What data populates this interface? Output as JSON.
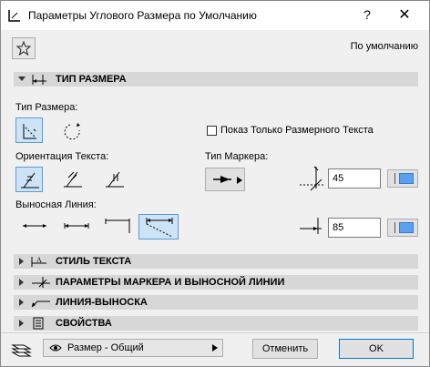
{
  "window": {
    "title": "Параметры Углового Размера по Умолчанию",
    "help": "?",
    "close": "✕"
  },
  "toolbar": {
    "default_label": "По умолчанию"
  },
  "sections": {
    "dim_type": "ТИП РАЗМЕРА",
    "text_style": "СТИЛЬ ТЕКСТА",
    "marker_ext": "ПАРАМЕТРЫ МАРКЕРА И ВЫНОСНОЙ ЛИНИИ",
    "leader": "ЛИНИЯ-ВЫНОСКА",
    "properties": "СВОЙСТВА"
  },
  "dim_type": {
    "type_label": "Тип Размера:",
    "orientation_label": "Ориентация Текста:",
    "witness_label": "Выносная Линия:",
    "show_text_only_label": "Показ Только Размерного Текста",
    "show_text_only": false,
    "marker_type_label": "Тип Маркера:",
    "marker_angle_value": "45",
    "witness_value": "85"
  },
  "footer": {
    "layer_dropdown": "Размер - Общий",
    "cancel": "Отменить",
    "ok": "OK"
  },
  "colors": {
    "accent": "#0078d7",
    "toggle_on": "#cde4f7",
    "pen_swatch": "#5aa0f0"
  }
}
